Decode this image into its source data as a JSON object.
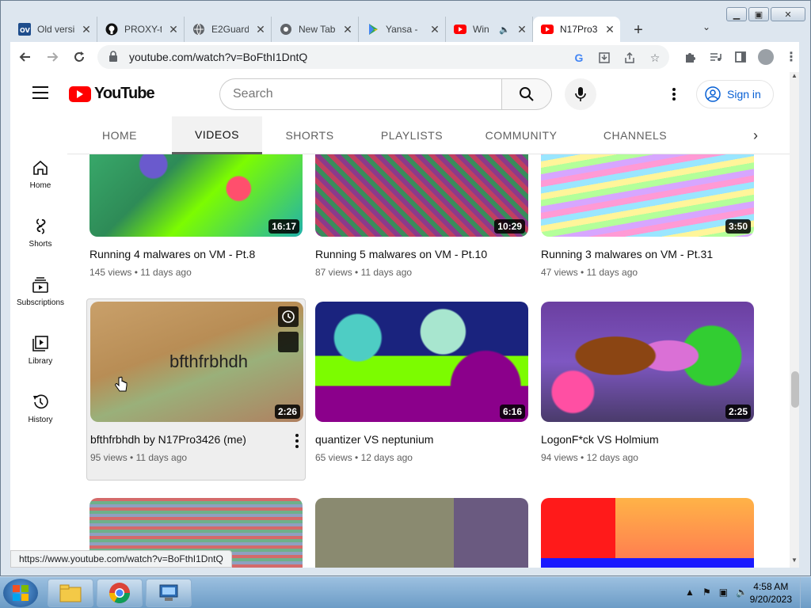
{
  "browser": {
    "tabs": [
      {
        "title": "Old versi",
        "icon": "ov-icon"
      },
      {
        "title": "PROXY-t",
        "icon": "github-icon"
      },
      {
        "title": "E2Guard",
        "icon": "globe-icon"
      },
      {
        "title": "New Tab",
        "icon": "chrome-icon"
      },
      {
        "title": "Yansa - ",
        "icon": "play-store-icon"
      },
      {
        "title": "Win",
        "icon": "youtube-icon"
      },
      {
        "title": "N17Pro3",
        "icon": "youtube-icon"
      }
    ],
    "url": "youtube.com/watch?v=BoFthI1DntQ",
    "status_url": "https://www.youtube.com/watch?v=BoFthI1DntQ"
  },
  "youtube": {
    "logo": "YouTube",
    "search_placeholder": "Search",
    "signin": "Sign in",
    "guide": [
      {
        "label": "Home",
        "icon": "home-icon"
      },
      {
        "label": "Shorts",
        "icon": "shorts-icon"
      },
      {
        "label": "Subscriptions",
        "icon": "subscriptions-icon"
      },
      {
        "label": "Library",
        "icon": "library-icon"
      },
      {
        "label": "History",
        "icon": "history-icon"
      }
    ],
    "channel_tabs": [
      "HOME",
      "VIDEOS",
      "SHORTS",
      "PLAYLISTS",
      "COMMUNITY",
      "CHANNELS"
    ],
    "active_tab": "VIDEOS",
    "videos": [
      {
        "title": "Running 4 malwares on VM - Pt.8",
        "views": "145 views",
        "age": "11 days ago",
        "duration": "16:17"
      },
      {
        "title": "Running 5 malwares on VM - Pt.10",
        "views": "87 views",
        "age": "11 days ago",
        "duration": "10:29"
      },
      {
        "title": "Running 3 malwares on VM - Pt.31",
        "views": "47 views",
        "age": "11 days ago",
        "duration": "3:50"
      },
      {
        "title": "bfthfrbhdh by N17Pro3426 (me)",
        "views": "95 views",
        "age": "11 days ago",
        "duration": "2:26",
        "thumb_text": "bfthfrbhdh"
      },
      {
        "title": "quantizer VS neptunium",
        "views": "65 views",
        "age": "12 days ago",
        "duration": "6:16"
      },
      {
        "title": "LogonF*ck VS Holmium",
        "views": "94 views",
        "age": "12 days ago",
        "duration": "2:25"
      }
    ],
    "meta_separator": "•"
  },
  "taskbar": {
    "clock_time": "4:58 AM",
    "clock_date": "9/20/2023"
  }
}
